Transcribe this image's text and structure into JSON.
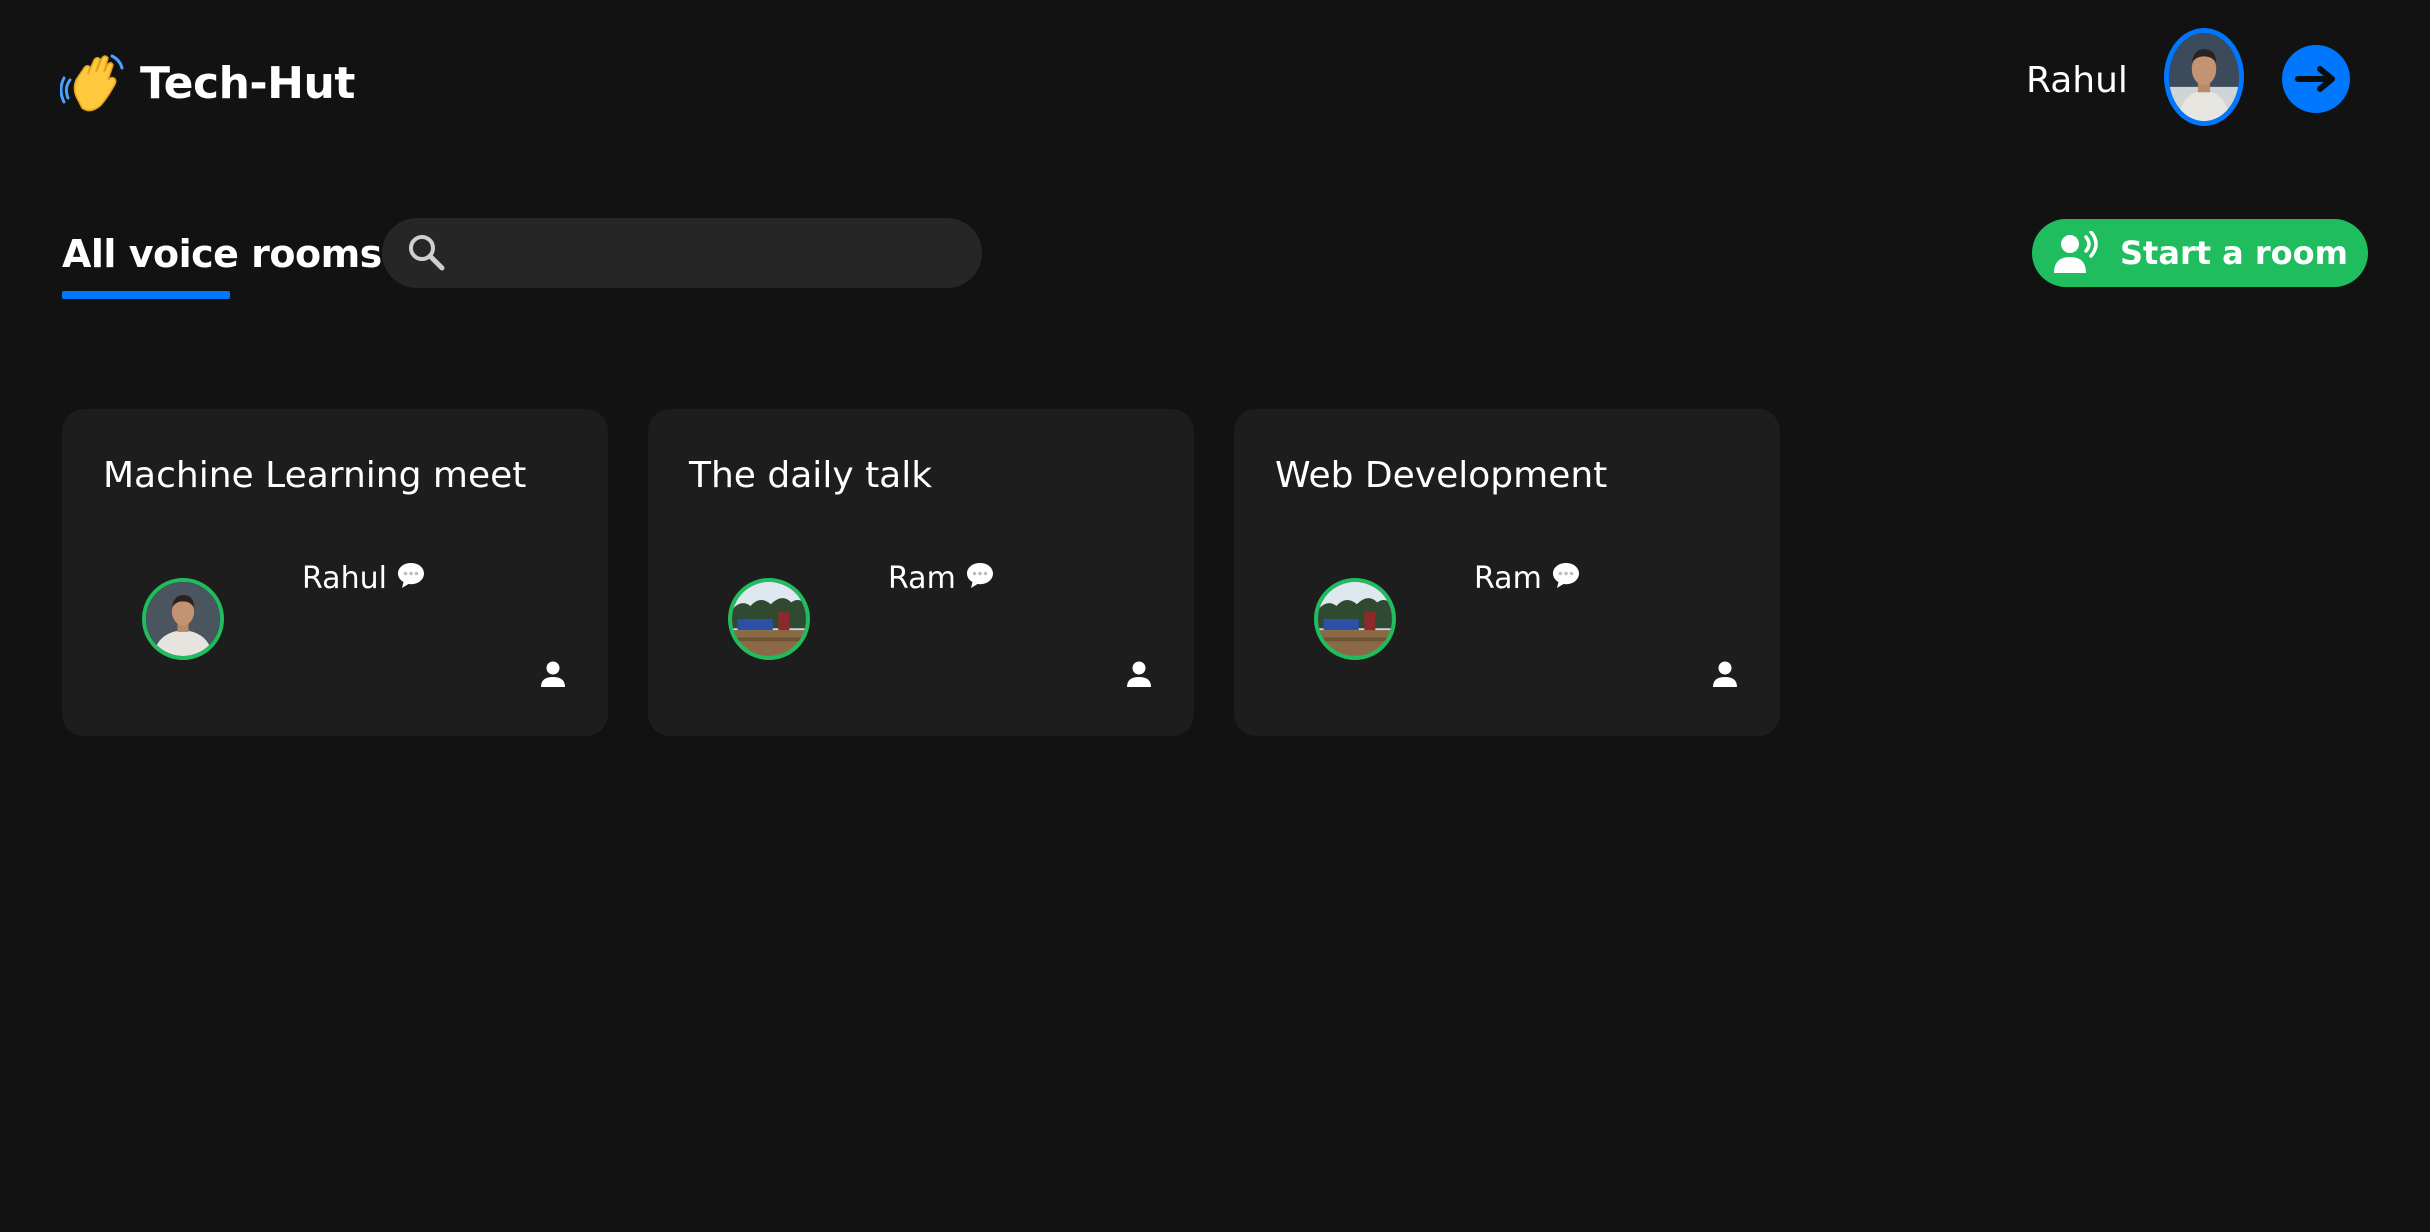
{
  "app": {
    "brand_name": "Tech-Hut",
    "brand_icon": "waving-hand-icon"
  },
  "header": {
    "user_name": "Rahul",
    "logout_icon": "arrow-right-icon",
    "accent_color": "#0077ff"
  },
  "toolbar": {
    "title": "All voice rooms",
    "search_placeholder": "",
    "search_value": "",
    "start_room_label": "Start a room",
    "start_room_icon": "speaking-person-icon",
    "start_room_color": "#20bd5f"
  },
  "rooms": [
    {
      "topic": "Machine Learning meet",
      "speaker": "Rahul",
      "speaker_avatar": "person-photo"
    },
    {
      "topic": "The daily talk",
      "speaker": "Ram",
      "speaker_avatar": "landscape-photo"
    },
    {
      "topic": "Web Development",
      "speaker": "Ram",
      "speaker_avatar": "landscape-photo"
    }
  ]
}
